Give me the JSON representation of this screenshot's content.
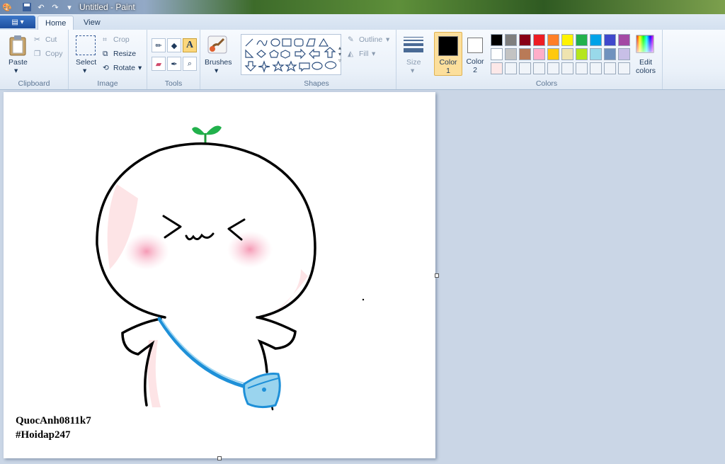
{
  "window": {
    "title": "Untitled - Paint"
  },
  "tabs": [
    {
      "label": "Home"
    },
    {
      "label": "View"
    }
  ],
  "clipboard": {
    "paste": "Paste",
    "cut": "Cut",
    "copy": "Copy",
    "group": "Clipboard"
  },
  "image": {
    "select": "Select",
    "crop": "Crop",
    "resize": "Resize",
    "rotate": "Rotate",
    "group": "Image"
  },
  "tools": {
    "group": "Tools",
    "brushes": "Brushes"
  },
  "shapes": {
    "outline": "Outline",
    "fill": "Fill",
    "group": "Shapes"
  },
  "size": {
    "label": "Size"
  },
  "colors": {
    "color1_a": "Color",
    "color1_b": "1",
    "color2_a": "Color",
    "color2_b": "2",
    "edit_a": "Edit",
    "edit_b": "colors",
    "group": "Colors",
    "palette_row1": [
      "#000000",
      "#7f7f7f",
      "#880015",
      "#ed1c24",
      "#ff7f27",
      "#fff200",
      "#22b14c",
      "#00a2e8",
      "#3f48cc",
      "#a349a4"
    ],
    "palette_row2": [
      "#ffffff",
      "#c3c3c3",
      "#b97a57",
      "#ffaec9",
      "#ffc90e",
      "#efe4b0",
      "#b5e61d",
      "#99d9ea",
      "#7092be",
      "#c8bfe7"
    ],
    "palette_row3": [
      "#fde8e8",
      "#f0f4f9",
      "#f0f4f9",
      "#f0f4f9",
      "#f0f4f9",
      "#f0f4f9",
      "#f0f4f9",
      "#f0f4f9",
      "#f0f4f9",
      "#f0f4f9"
    ],
    "color1_value": "#000000",
    "color2_value": "#ffffff"
  },
  "drawing": {
    "signature_line1": "QuocAnh0811k7",
    "signature_line2": "#Hoidap247"
  }
}
